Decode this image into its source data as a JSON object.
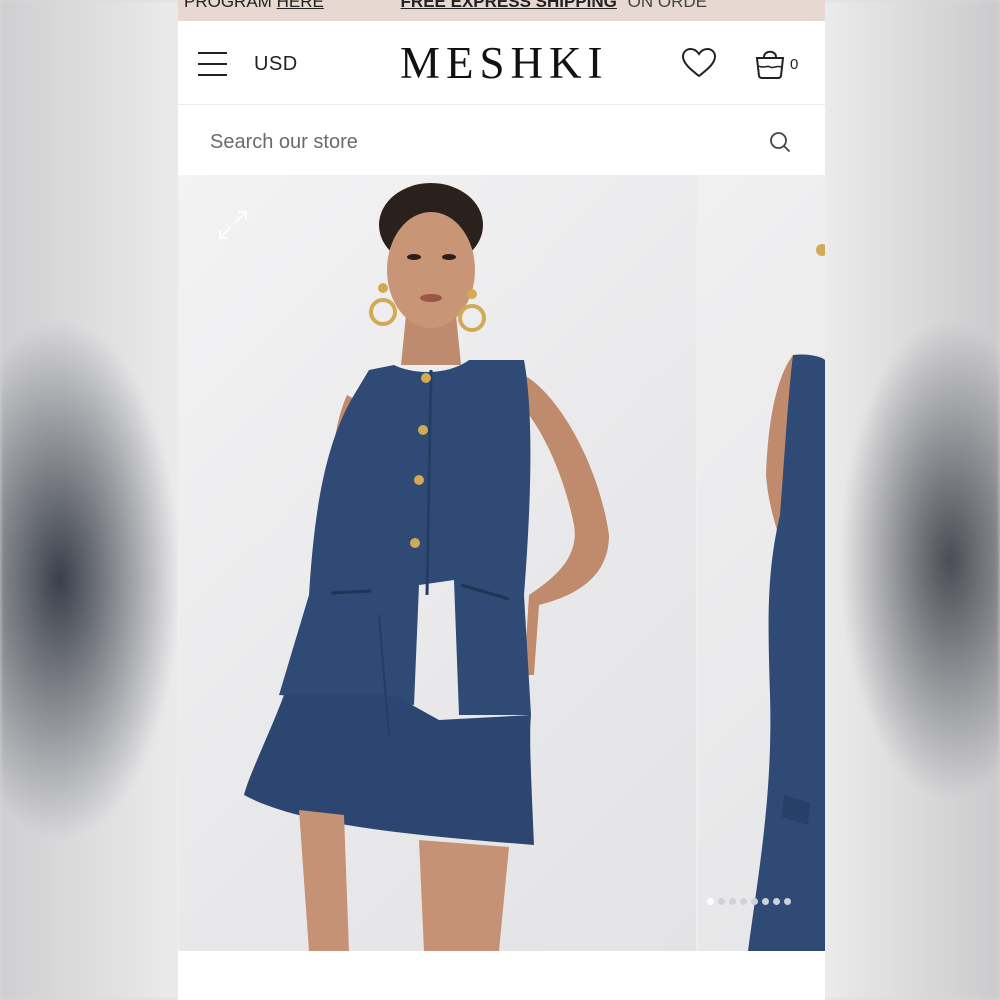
{
  "announcement": {
    "program_text": "PROGRAM",
    "program_link": "HERE",
    "shipping": "FREE EXPRESS SHIPPING",
    "shipping_tail": "ON ORDE"
  },
  "header": {
    "currency": "USD",
    "logo": "MESHKI",
    "cart_count": "0",
    "icons": [
      "menu-icon",
      "heart-icon",
      "cart-icon"
    ]
  },
  "search": {
    "placeholder": "Search our store",
    "icon": "search-icon"
  },
  "gallery": {
    "slide_count": 8,
    "active_slide": 1,
    "expand_icon": "expand-icon"
  },
  "colors": {
    "announcement_bg": "#e7d9d1",
    "denim": "#2e4a75",
    "skin": "#c99577",
    "gold": "#d2aa55"
  }
}
